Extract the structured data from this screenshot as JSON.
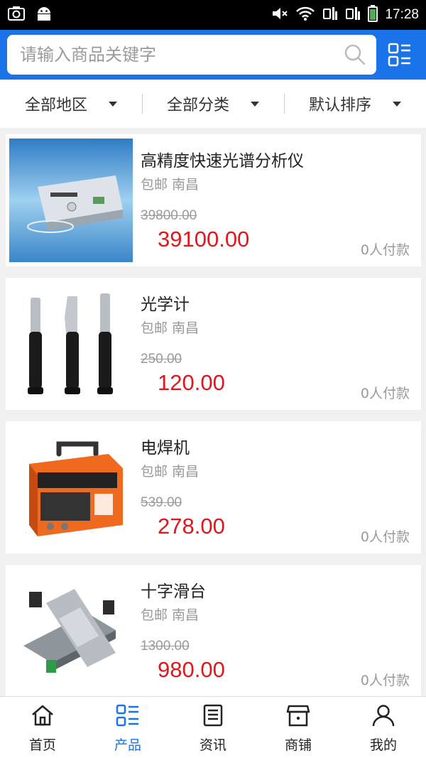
{
  "status_bar": {
    "time": "17:28"
  },
  "search": {
    "placeholder": "请输入商品关键字"
  },
  "filters": [
    {
      "label": "全部地区"
    },
    {
      "label": "全部分类"
    },
    {
      "label": "默认排序"
    }
  ],
  "products": [
    {
      "title": "高精度快速光谱分析仪",
      "location": "包邮 南昌",
      "original_price": "39800.00",
      "price": "39100.00",
      "paid": "0人付款",
      "image": "spectrum-analyzer"
    },
    {
      "title": "光学计",
      "location": "包邮 南昌",
      "original_price": "250.00",
      "price": "120.00",
      "paid": "0人付款",
      "image": "refractometers"
    },
    {
      "title": "电焊机",
      "location": "包邮 南昌",
      "original_price": "539.00",
      "price": "278.00",
      "paid": "0人付款",
      "image": "welding-machine"
    },
    {
      "title": "十字滑台",
      "location": "包邮 南昌",
      "original_price": "1300.00",
      "price": "980.00",
      "paid": "0人付款",
      "image": "cross-slide-table"
    }
  ],
  "tabs": [
    {
      "label": "首页",
      "icon": "home-icon"
    },
    {
      "label": "产品",
      "icon": "grid-list-icon",
      "active": true
    },
    {
      "label": "资讯",
      "icon": "news-icon"
    },
    {
      "label": "商铺",
      "icon": "store-icon"
    },
    {
      "label": "我的",
      "icon": "user-icon"
    }
  ],
  "colors": {
    "header": "#1a73e8",
    "price": "#e0181d",
    "active_tab": "#1a73e8"
  }
}
